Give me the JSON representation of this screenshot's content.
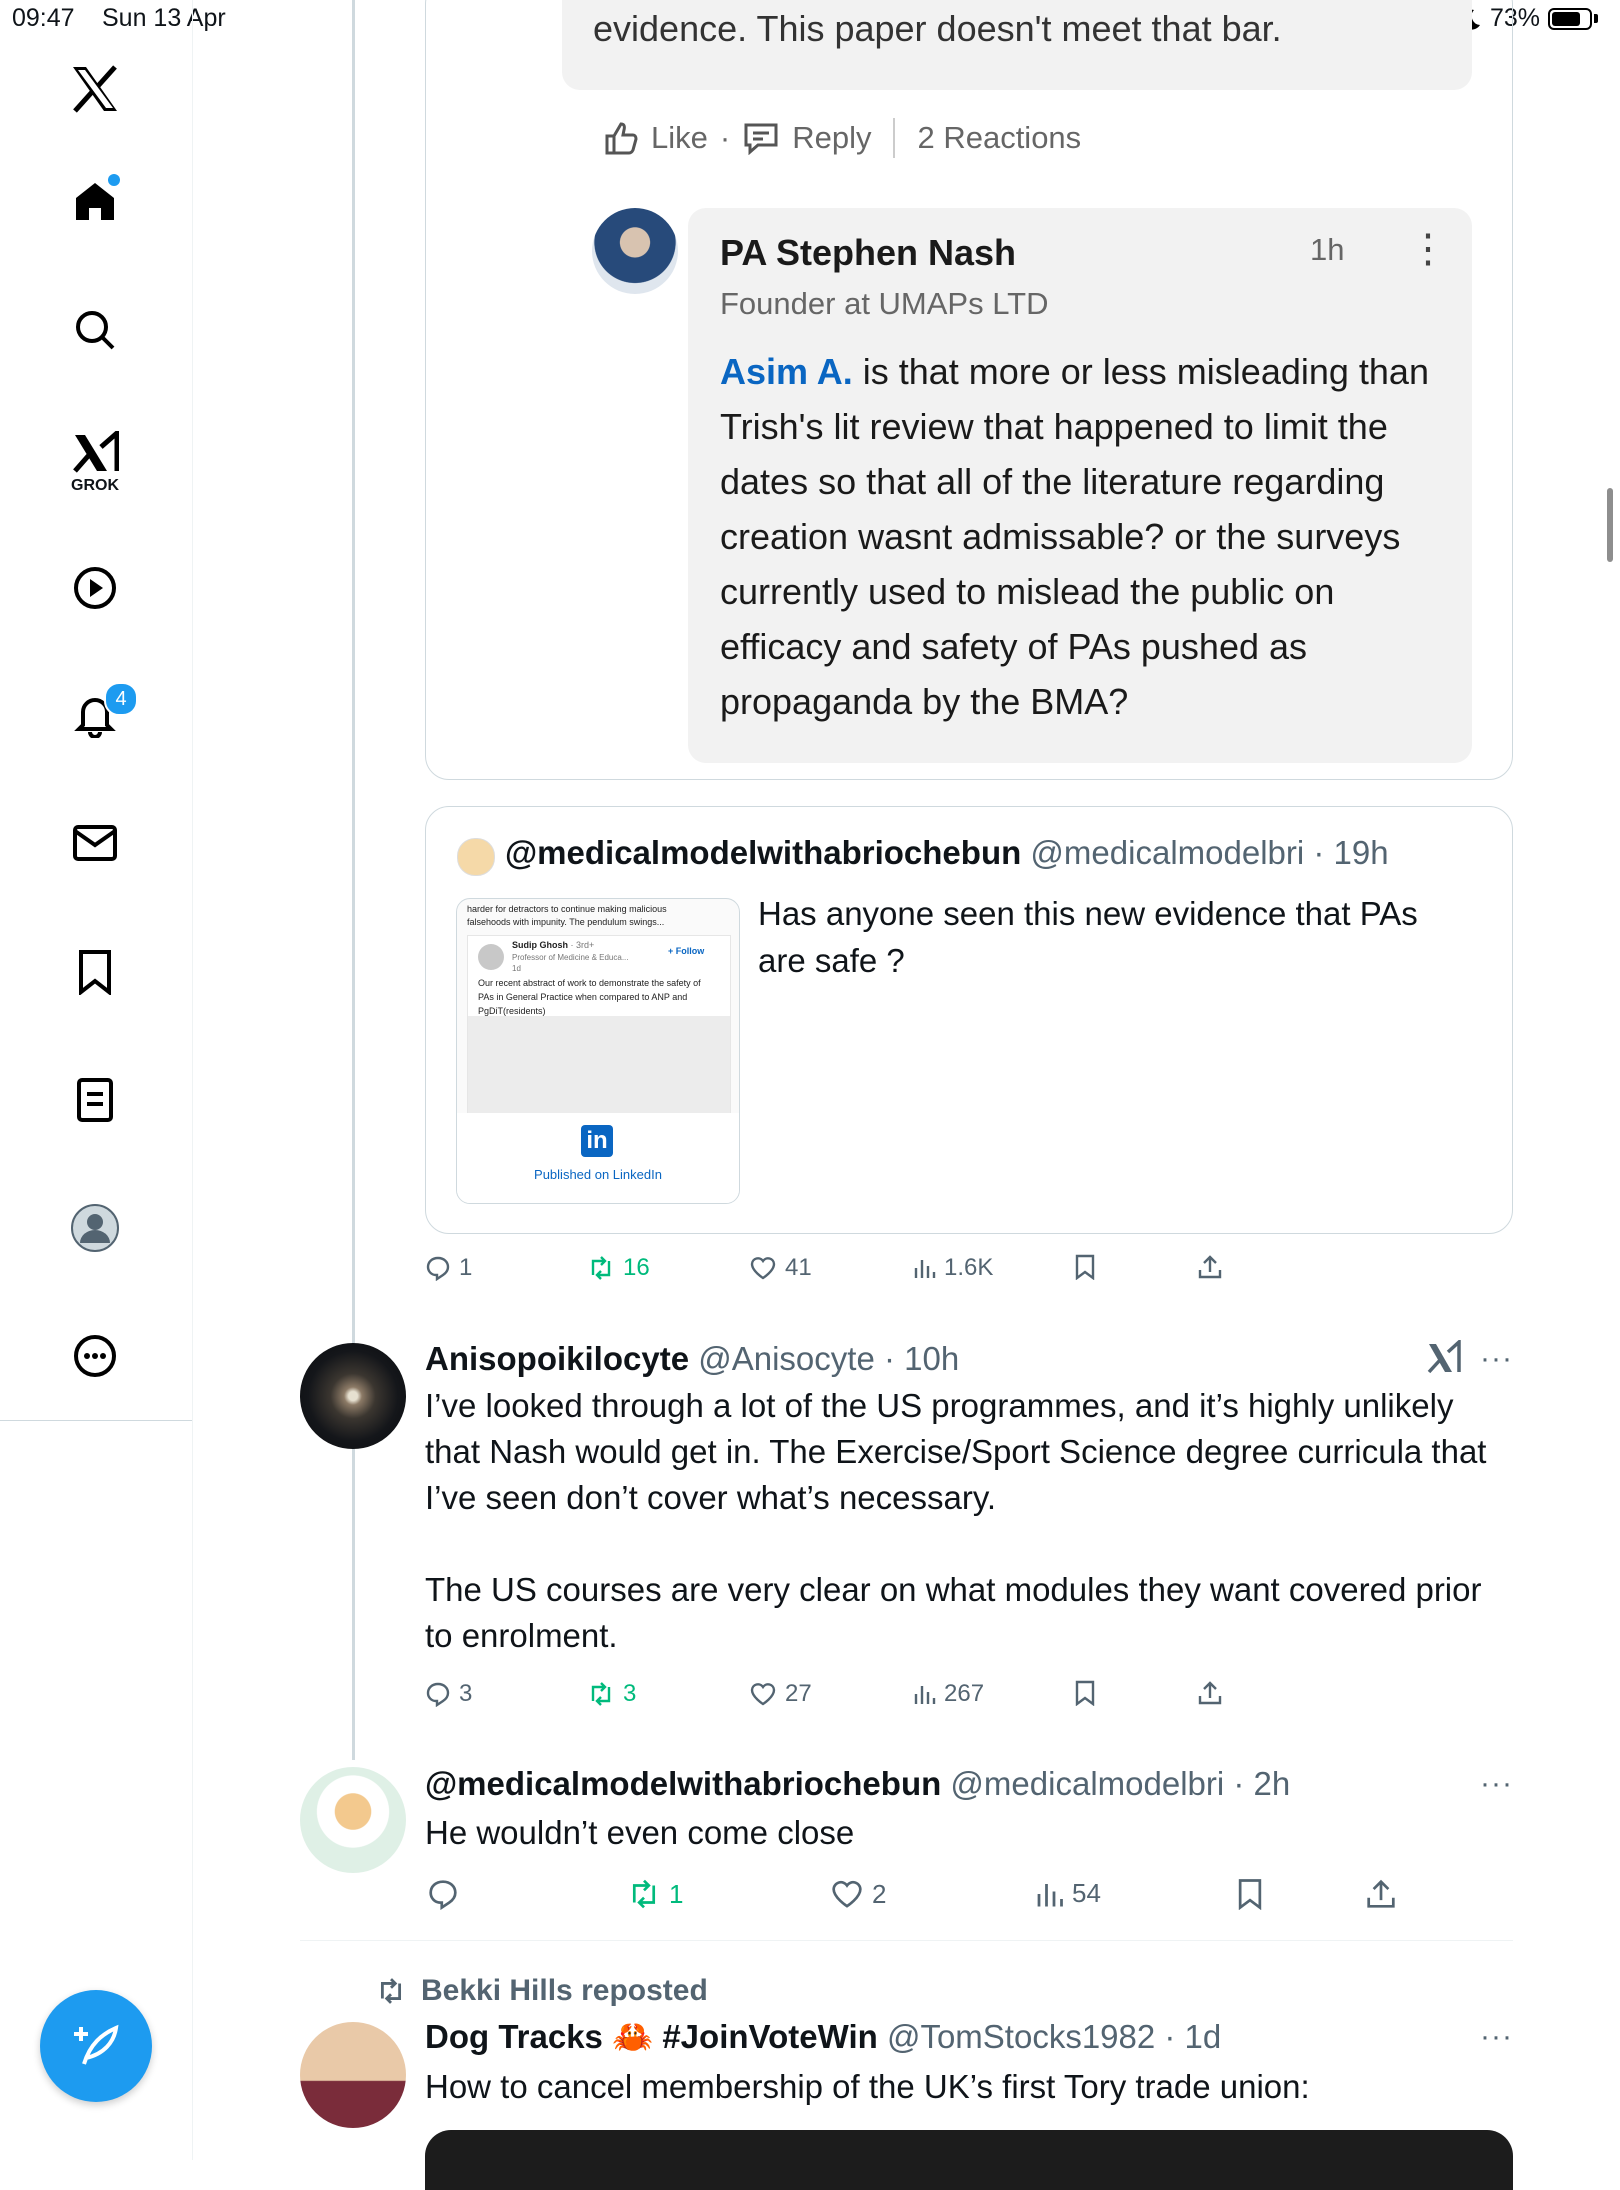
{
  "status_bar": {
    "time": "09:47",
    "date": "Sun 13 Apr",
    "battery": "73%"
  },
  "sidebar": {
    "grok_label": "GROK",
    "notifications_count": "4"
  },
  "linkedin_comment_1": {
    "text": "evidence. This paper doesn't meet that bar.",
    "like": "Like",
    "reply": "Reply",
    "reactions": "2 Reactions"
  },
  "linkedin_comment_2": {
    "name": "PA Stephen Nash",
    "time": "1h",
    "title": "Founder at UMAPs LTD",
    "mention": "Asim A.",
    "body": " is that more or less misleading than Trish's lit review that happened to limit the dates so that all of the literature regarding creation wasnt admissable? or the surveys currently used to mislead the public on efficacy and safety of PAs pushed as propaganda by the BMA?"
  },
  "quoted_tweet": {
    "display_name": "@medicalmodelwithabriochebun",
    "handle_time": " @medicalmodelbri · 19h",
    "text": "Has anyone seen this new evidence that PAs are safe ?",
    "thumb": {
      "top_line1": "harder for detractors to continue making malicious",
      "top_line2": "falsehoods with impunity. The pendulum swings...",
      "author": "Sudip Ghosh",
      "degree": " · 3rd+",
      "follow": "+ Follow",
      "role": "Professor of Medicine & Educa...",
      "age": "1d",
      "body": "Our recent abstract of work to demonstrate the safety of PAs in General Practice when compared to ANP and PgDiT(residents)",
      "published": "Published on LinkedIn"
    }
  },
  "tweet_main_actions": {
    "replies": "1",
    "reposts": "16",
    "likes": "41",
    "views": "1.6K"
  },
  "tweets": [
    {
      "display_name": "Anisopoikilocyte",
      "handle_time": " @Anisocyte · 10h",
      "body_p1": "I’ve looked through a lot of the US programmes, and it’s highly unlikely that Nash would get in. The Exercise/Sport Science degree curricula that I’ve seen don’t cover what’s necessary.",
      "body_p2": "The US courses are very clear on what modules they want covered prior to enrolment.",
      "replies": "3",
      "reposts": "3",
      "likes": "27",
      "views": "267"
    },
    {
      "display_name": "@medicalmodelwithabriochebun",
      "handle_time": " @medicalmodelbri · 2h",
      "body_p1": "He wouldn’t even come close",
      "reposts": "1",
      "likes": "2",
      "views": "54"
    },
    {
      "repost_label": "Bekki Hills reposted",
      "display_name": "Dog Tracks 🦀 #JoinVoteWin",
      "handle_time": " @TomStocks1982 · 1d",
      "body_p1": "How to cancel membership of the UK’s first Tory trade union:"
    }
  ],
  "colors": {
    "accent": "#1d9bf0",
    "repost_green": "#00ba7c",
    "linkedin_blue": "#0a66c2"
  }
}
